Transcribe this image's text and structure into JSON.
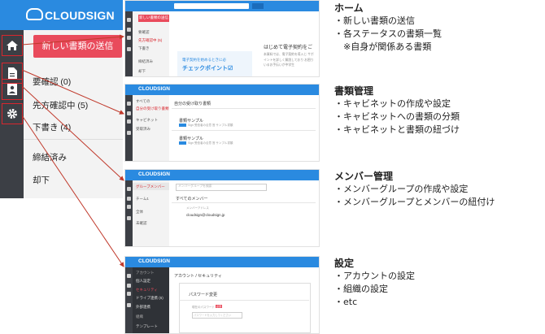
{
  "brand": "CLOUDSIGN",
  "big_panel": {
    "send_button": "新しい書類の送信",
    "items": [
      "要確認 (0)",
      "先方確認中 (5)",
      "下書き (4)",
      "締結済み",
      "却下"
    ]
  },
  "mini_home": {
    "send_button": "新しい書類の送信",
    "side_items": [
      "要確認",
      "先方確認中 (5)",
      "下書き",
      "締結済み",
      "却下"
    ],
    "heading": "はじめて電子契約をご",
    "body": "本資料では、電子契約を導入じ サポイントを詳しく解説しており お困りいるお手伝いが中学生",
    "banner_line1": "電子契約を始めるときに必",
    "banner_line2": "チェックポイント",
    "banner_check": "☑"
  },
  "mini_docs": {
    "side_items": [
      "すべての",
      "自分の受け取り書類",
      "キャビネット",
      "受取済み"
    ],
    "title": "自分の受け取り書類",
    "docs": [
      {
        "title": "書類サンプル",
        "meta": "Sign 受信者の合意  営 サンプル書類"
      },
      {
        "title": "書類サンプル",
        "meta": "Sign 受信者の合意  営 サンプル書類"
      }
    ]
  },
  "mini_members": {
    "side_items": [
      "グループメンバー",
      "チーム1",
      "全体",
      "未確認"
    ],
    "search_placeholder": "メンバーグループを検索",
    "title": "すべてのメンバー",
    "label": "メンバーアドレス",
    "email": "cloudsign@cloudsign.jp"
  },
  "mini_settings": {
    "side_items": [
      "アカウント",
      "個人設定",
      "セキュリティ",
      "ドライブ連携 (6)",
      "外部連携",
      "組織",
      "テンプレート"
    ],
    "title": "アカウント / セキュリティ",
    "section": "パスワード変更",
    "field_label": "現在のパスワード",
    "required": "必須",
    "placeholder": "パスワードを入力してください"
  },
  "descriptions": [
    {
      "heading": "ホーム",
      "lines": [
        "・新しい書類の送信",
        "・各ステータスの書類一覧",
        "　※自身が関係ある書類"
      ]
    },
    {
      "heading": "書類管理",
      "lines": [
        "・キャビネットの作成や設定",
        "・キャビネットへの書類の分類",
        "・キャビネットと書類の紐づけ"
      ]
    },
    {
      "heading": "メンバー管理",
      "lines": [
        "・メンバーグループの作成や設定",
        "・メンバーグループとメンバーの紐付け"
      ]
    },
    {
      "heading": "設定",
      "lines": [
        "・アカウントの設定",
        "・組織の設定",
        "・etc"
      ]
    }
  ],
  "colors": {
    "brand_blue": "#2a8ae0",
    "rail_dark": "#3c3f45",
    "send_red": "#e94b5c",
    "arrow_red": "#c0392b"
  },
  "icons": [
    "cloud-icon",
    "home-icon",
    "document-icon",
    "contact-card-icon",
    "gear-icon"
  ]
}
